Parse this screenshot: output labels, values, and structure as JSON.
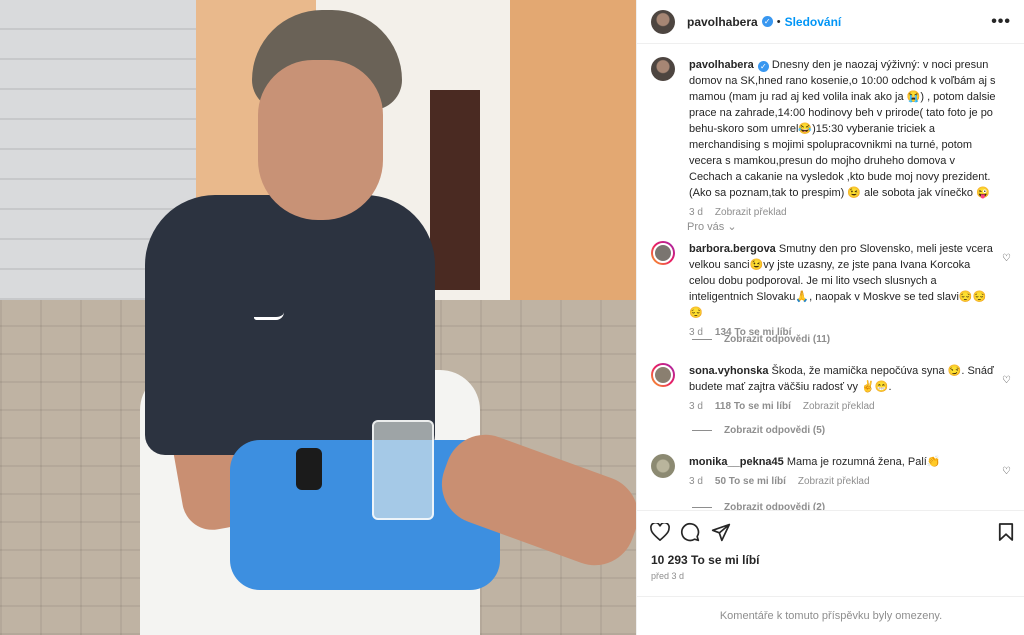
{
  "post": {
    "username": "pavolhabera",
    "follow_label": "Sledování",
    "separator": "•",
    "more_label": "•••",
    "caption": "Dnesny den je naozaj výživný: v noci presun domov na SK,hned rano kosenie,o 10:00 odchod k voľbám aj s mamou (mam ju rad aj ked volila inak ako ja 😭) , potom dalsie prace na zahrade,14:00 hodinovy beh v prirode( tato foto je po behu-skoro som umrel😂)15:30 vyberanie triciek a merchandising s mojimi spolupracovnikmi na turné, potom vecera s mamkou,presun do mojho druheho domova v Cechach a cakanie na vysledok ,kto bude moj novy prezident. (Ako sa poznam,tak to prespim) 😉 ale sobota jak vínečko 😜",
    "caption_time": "3 d",
    "translate_label": "Zobrazit překlad",
    "for_you_label": "Pro vás",
    "chevron": "⌄"
  },
  "comments": [
    {
      "username": "barbora.bergova",
      "text": "Smutny den pro Slovensko, meli jeste vcera velkou sanci😉vy jste uzasny, ze jste pana Ivana Korcoka celou dobu podporoval. Je mi lito vsech slusnych a inteligentnich Slovaku🙏, naopak v Moskve se ted slavi😔😔😔",
      "time": "3 d",
      "likes": "134 To se mi líbí",
      "translate": "",
      "replies": "Zobrazit odpovědi (11)"
    },
    {
      "username": "sona.vyhonska",
      "text": "Škoda, že mamička nepočúva syna 😏. Snáď budete mať zajtra väčšiu radosť vy ✌️😁.",
      "time": "3 d",
      "likes": "118 To se mi líbí",
      "translate": "Zobrazit překlad",
      "replies": "Zobrazit odpovědi (5)"
    },
    {
      "username": "monika__pekna45",
      "text": "Mama je rozumná žena, Palí👏",
      "time": "3 d",
      "likes": "50 To se mi líbí",
      "translate": "Zobrazit překlad",
      "replies": "Zobrazit odpovědi (2)"
    }
  ],
  "footer": {
    "likes_label": "10 293 To se mi líbí",
    "posted_ago": "před 3 d",
    "comments_limited": "Komentáře k tomuto příspěvku byly omezeny."
  },
  "icons": [
    "heart-icon",
    "comment-icon",
    "share-icon",
    "bookmark-icon",
    "more-icon",
    "verified-icon"
  ],
  "colors": {
    "accent": "#0095f6",
    "verified": "#3897f0",
    "muted": "#8e8e8e"
  }
}
